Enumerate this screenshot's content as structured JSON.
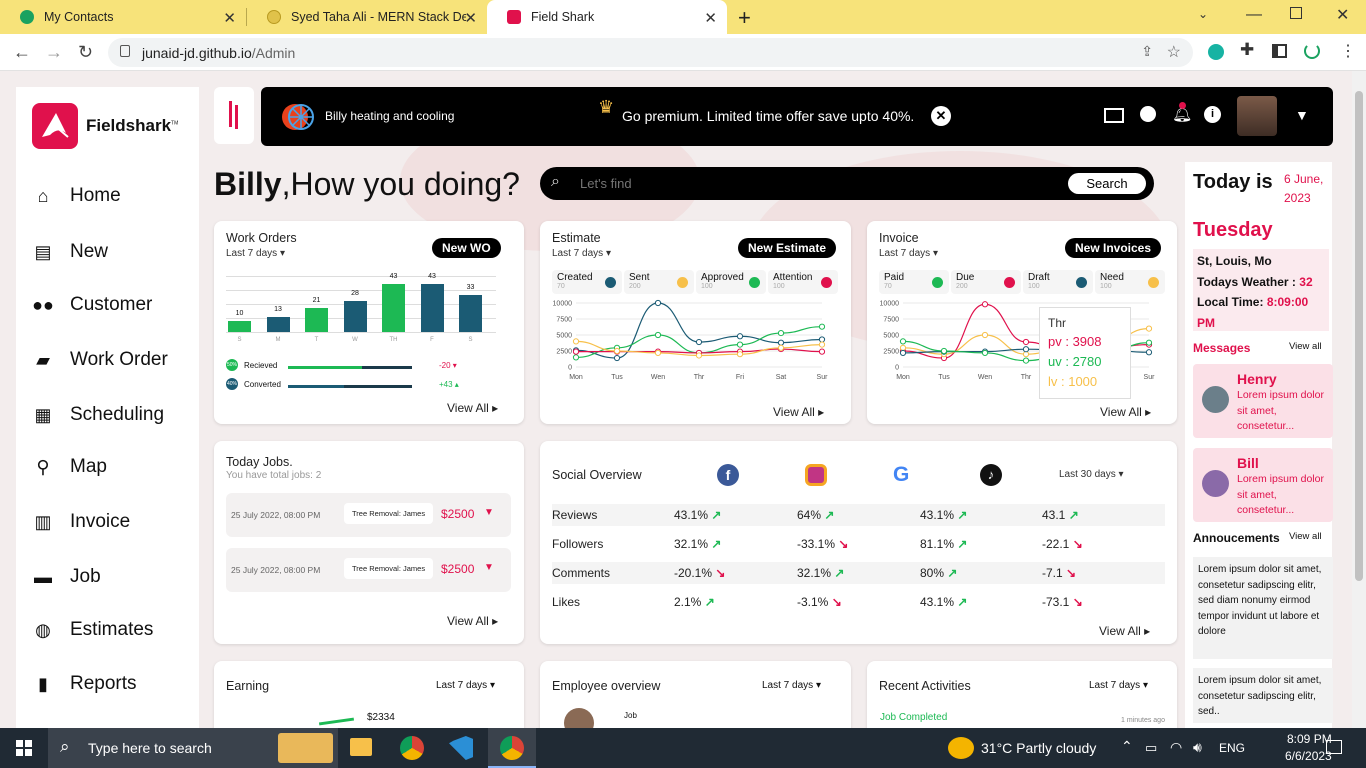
{
  "browser": {
    "tabs": [
      {
        "title": "My Contacts"
      },
      {
        "title": "Syed Taha Ali - MERN Stack Deve"
      },
      {
        "title": "Field Shark"
      }
    ],
    "url_host": "junaid-jd.github.io",
    "url_path": "/Admin"
  },
  "brand": {
    "logo_text": "Fieldshark",
    "logo_tm": "TM",
    "color": "#e0114c"
  },
  "sidebar": {
    "items": [
      {
        "label": "Home",
        "icon": "home-icon"
      },
      {
        "label": "New",
        "icon": "new-file-icon"
      },
      {
        "label": "Customer",
        "icon": "customers-icon"
      },
      {
        "label": "Work Order",
        "icon": "shopping-bag-icon"
      },
      {
        "label": "Scheduling",
        "icon": "calendar-icon"
      },
      {
        "label": "Map",
        "icon": "map-pin-icon"
      },
      {
        "label": "Invoice",
        "icon": "invoice-icon"
      },
      {
        "label": "Job",
        "icon": "briefcase-icon"
      },
      {
        "label": "Estimates",
        "icon": "estimates-icon"
      },
      {
        "label": "Reports",
        "icon": "reports-icon"
      }
    ]
  },
  "topbar": {
    "company": "Billy heating and cooling",
    "premium": "Go premium. Limited time offer save upto 40%."
  },
  "greeting": {
    "name": "Billy",
    "text": ",How you doing?"
  },
  "search": {
    "placeholder": "Let's find",
    "button": "Search"
  },
  "work_orders": {
    "title": "Work Orders",
    "period": "Last 7 days",
    "button": "New WO",
    "bars": [
      {
        "day": "S",
        "value": 10,
        "color": "#1db954"
      },
      {
        "day": "M",
        "value": 13,
        "color": "#1b5b74"
      },
      {
        "day": "T",
        "value": 21,
        "color": "#1db954"
      },
      {
        "day": "W",
        "value": 28,
        "color": "#1b5b74"
      },
      {
        "day": "TH",
        "value": 43,
        "color": "#1db954"
      },
      {
        "day": "F",
        "value": 43,
        "color": "#1b5b74"
      },
      {
        "day": "S",
        "value": 33,
        "color": "#1b5b74"
      }
    ],
    "stats": [
      {
        "pct": "50%",
        "label": "Recieved",
        "delta": "-20",
        "fill": 0.6,
        "color": "#1db954"
      },
      {
        "pct": "40%",
        "label": "Converted",
        "delta": "+43",
        "fill": 0.45,
        "color": "#1b5b74"
      }
    ],
    "view_all": "View All"
  },
  "estimate": {
    "title": "Estimate",
    "period": "Last 7 days",
    "button": "New Estimate",
    "legend": [
      {
        "label": "Created",
        "value": "70",
        "color": "#1b5b74"
      },
      {
        "label": "Sent",
        "value": "200",
        "color": "#f7c04a"
      },
      {
        "label": "Approved",
        "value": "100",
        "color": "#1db954"
      },
      {
        "label": "Attention",
        "value": "100",
        "color": "#e0114c"
      }
    ],
    "view_all": "View All"
  },
  "invoice": {
    "title": "Invoice",
    "period": "Last 7 days",
    "button": "New Invoices",
    "legend": [
      {
        "label": "Paid",
        "value": "70",
        "color": "#1db954"
      },
      {
        "label": "Due",
        "value": "200",
        "color": "#e0114c"
      },
      {
        "label": "Draft",
        "value": "100",
        "color": "#1b5b74"
      },
      {
        "label": "Need",
        "value": "100",
        "color": "#f7c04a"
      }
    ],
    "tooltip": {
      "title": "Thr",
      "pv": "pv : 3908",
      "uv": "uv : 2780",
      "lv": "lv : 1000"
    },
    "view_all": "View All"
  },
  "chart_data": [
    {
      "type": "line",
      "title": "Estimate",
      "x": [
        "Mon",
        "Tus",
        "Wen",
        "Thr",
        "Fri",
        "Sat",
        "Sur"
      ],
      "ylim": [
        0,
        10000
      ],
      "yticks": [
        "10000",
        "7500",
        "5000",
        "2500",
        "0"
      ],
      "series": [
        {
          "color": "#1b5b74",
          "values": [
            2600,
            1400,
            10000,
            3900,
            4800,
            3800,
            4300
          ]
        },
        {
          "color": "#1db954",
          "values": [
            1500,
            3000,
            5000,
            2200,
            3500,
            5300,
            6300
          ]
        },
        {
          "color": "#e0114c",
          "values": [
            2400,
            2400,
            2400,
            2200,
            2400,
            2800,
            2400
          ]
        },
        {
          "color": "#f7c04a",
          "values": [
            4000,
            2500,
            2200,
            1800,
            2000,
            3000,
            3500
          ]
        }
      ]
    },
    {
      "type": "line",
      "title": "Invoice",
      "x": [
        "Mon",
        "Tus",
        "Wen",
        "Thr",
        "Fri",
        "Sat",
        "Sur"
      ],
      "ylim": [
        0,
        10000
      ],
      "yticks": [
        "10000",
        "7500",
        "5000",
        "2500",
        "0"
      ],
      "series": [
        {
          "color": "#e0114c",
          "values": [
            2500,
            1400,
            9800,
            3908,
            2500,
            3000,
            3500
          ]
        },
        {
          "color": "#f7c04a",
          "values": [
            3000,
            2000,
            5000,
            2000,
            3000,
            4000,
            6000
          ]
        },
        {
          "color": "#1b5b74",
          "values": [
            2200,
            2400,
            2400,
            2780,
            2600,
            2600,
            2300
          ]
        },
        {
          "color": "#1db954",
          "values": [
            4000,
            2500,
            2200,
            1000,
            2000,
            2500,
            3800
          ]
        }
      ]
    }
  ],
  "today_jobs": {
    "title": "Today Jobs.",
    "subtitle": "You have total jobs: 2",
    "jobs": [
      {
        "date": "25 July 2022, 08:00 PM",
        "tag": "Tree Removal: James",
        "price": "$2500"
      },
      {
        "date": "25 July 2022, 08:00 PM",
        "tag": "Tree Removal: James",
        "price": "$2500"
      }
    ],
    "view_all": "View All"
  },
  "social": {
    "title": "Social Overview",
    "period": "Last 30 days",
    "platforms": [
      {
        "name": "facebook-icon",
        "color": "#3b5998"
      },
      {
        "name": "instagram-icon",
        "color": "#c13584"
      },
      {
        "name": "google-icon",
        "color": "#4285f4"
      },
      {
        "name": "tiktok-icon",
        "color": "#111"
      }
    ],
    "rows": [
      {
        "label": "Reviews",
        "values": [
          {
            "v": "43.1%",
            "t": "up"
          },
          {
            "v": "64%",
            "t": "up"
          },
          {
            "v": "43.1%",
            "t": "up"
          },
          {
            "v": "43.1",
            "t": "up"
          }
        ]
      },
      {
        "label": "Followers",
        "values": [
          {
            "v": "32.1%",
            "t": "up"
          },
          {
            "v": "-33.1%",
            "t": "down"
          },
          {
            "v": "81.1%",
            "t": "up"
          },
          {
            "v": "-22.1",
            "t": "down"
          }
        ]
      },
      {
        "label": "Comments",
        "values": [
          {
            "v": "-20.1%",
            "t": "down"
          },
          {
            "v": "32.1%",
            "t": "up"
          },
          {
            "v": "80%",
            "t": "up"
          },
          {
            "v": "-7.1",
            "t": "down"
          }
        ]
      },
      {
        "label": "Likes",
        "values": [
          {
            "v": "2.1%",
            "t": "up"
          },
          {
            "v": "-3.1%",
            "t": "down"
          },
          {
            "v": "43.1%",
            "t": "up"
          },
          {
            "v": "-73.1",
            "t": "down"
          }
        ]
      }
    ],
    "view_all": "View All"
  },
  "earning": {
    "title": "Earning",
    "period": "Last 7 days",
    "value": "$2334"
  },
  "employee": {
    "title": "Employee overview",
    "period": "Last 7 days",
    "col": "Job"
  },
  "recent": {
    "title": "Recent Activities",
    "period": "Last 7 days",
    "item": "Job Completed",
    "time": "1 minutes ago"
  },
  "right": {
    "today_label": "Today is",
    "day": "Tuesday",
    "date": "6 June, 2023",
    "location": "St, Louis, Mo",
    "weather_label": "Todays Weather :",
    "weather_value": "32",
    "time_label": "Local Time:",
    "time_value": "8:09:00 PM",
    "messages_title": "Messages",
    "messages_view": "View all",
    "messages": [
      {
        "name": "Henry",
        "text": "Lorem ipsum dolor sit amet, consetetur..."
      },
      {
        "name": "Bill",
        "text": "Lorem ipsum dolor sit amet, consetetur..."
      }
    ],
    "ann_title": "Annoucements",
    "ann_view": "View all",
    "announcements": [
      "Lorem ipsum dolor sit amet, consetetur sadipscing elitr, sed diam nonumy eirmod tempor invidunt ut labore et dolore",
      "Lorem ipsum dolor sit amet, consetetur sadipscing elitr, sed.."
    ]
  },
  "taskbar": {
    "search": "Type here to search",
    "weather": "31°C  Partly cloudy",
    "lang": "ENG",
    "time": "8:09 PM",
    "date": "6/6/2023"
  }
}
